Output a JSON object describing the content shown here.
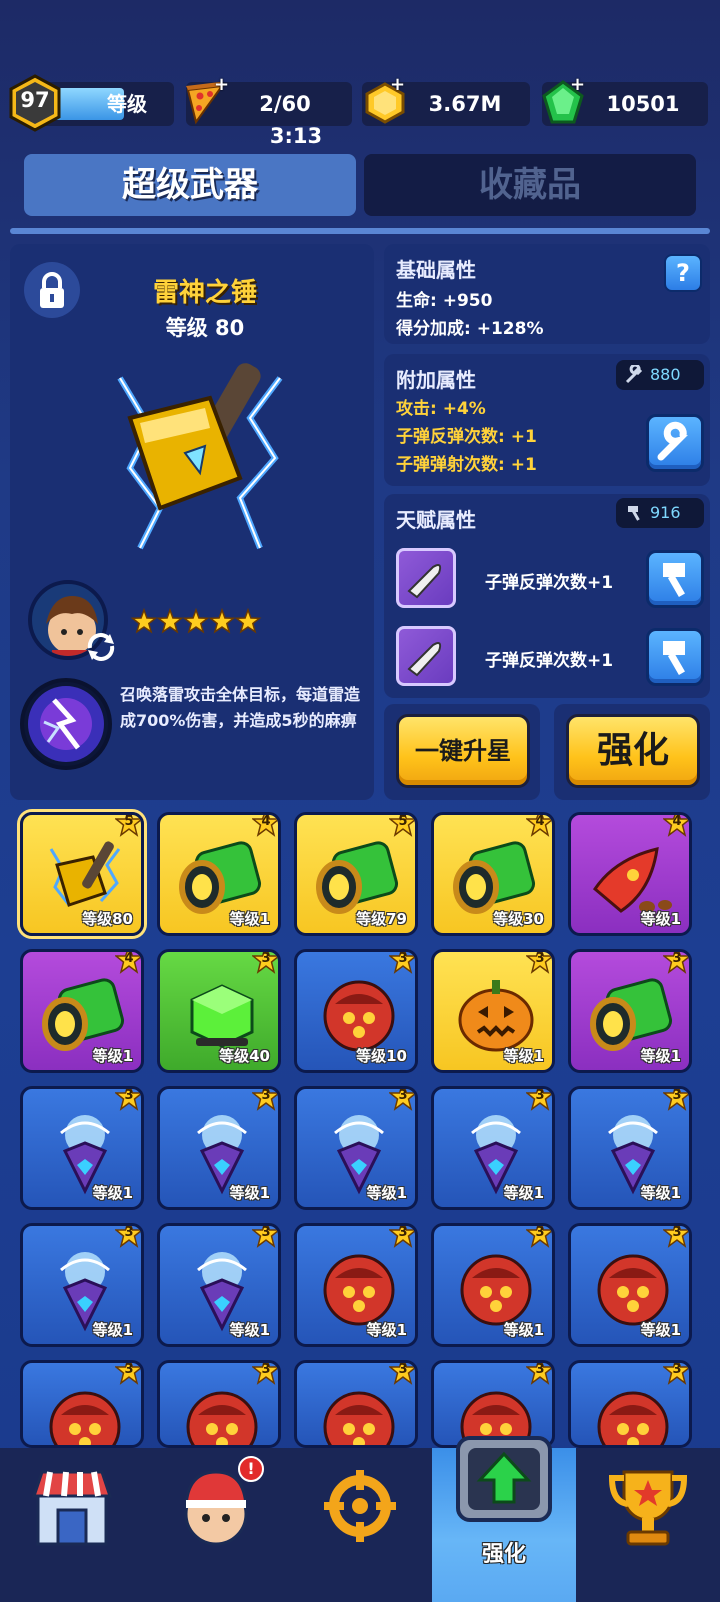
{
  "top_bar": {
    "player_level": "97",
    "level_label": "等级",
    "energy": "2/60",
    "energy_timer": "3:13",
    "coins": "3.67M",
    "gems": "10501"
  },
  "tabs": [
    {
      "label": "超级武器",
      "active": true
    },
    {
      "label": "收藏品",
      "active": false
    }
  ],
  "weapon": {
    "name": "雷神之锤",
    "level_text": "等级 80",
    "stars": 5,
    "skill_description": "召唤落雷攻击全体目标，每道雷造成700%伤害，并造成5秒的麻痹"
  },
  "base_attributes": {
    "title": "基础属性",
    "help_icon": "?",
    "lines": [
      "生命: +950",
      "得分加成: +128%"
    ]
  },
  "extra_attributes": {
    "title": "附加属性",
    "cost": "880",
    "lines": [
      "攻击: +4%",
      "子弹反弹次数: +1",
      "子弹弹射次数: +1"
    ]
  },
  "talent_attributes": {
    "title": "天赋属性",
    "cost": "916",
    "items": [
      {
        "label": "子弹反弹次数+1"
      },
      {
        "label": "子弹反弹次数+1"
      }
    ]
  },
  "actions": {
    "one_click_star": "一键升星",
    "enhance": "强化"
  },
  "grid": [
    {
      "kind": "hammer",
      "color": "gold",
      "stars": "5",
      "level": "等级80",
      "selected": true
    },
    {
      "kind": "cannon",
      "color": "gold",
      "stars": "4",
      "level": "等级1"
    },
    {
      "kind": "cannon",
      "color": "gold",
      "stars": "5",
      "level": "等级79"
    },
    {
      "kind": "cannon",
      "color": "gold",
      "stars": "4",
      "level": "等级30"
    },
    {
      "kind": "rocket",
      "color": "purple",
      "stars": "4",
      "level": "等级1"
    },
    {
      "kind": "cannon",
      "color": "purple",
      "stars": "4",
      "level": "等级1"
    },
    {
      "kind": "slime",
      "color": "green",
      "stars": "3",
      "level": "等级40"
    },
    {
      "kind": "mine",
      "color": "blue",
      "stars": "3",
      "level": "等级10"
    },
    {
      "kind": "pumpkin",
      "color": "gold",
      "stars": "3",
      "level": "等级1"
    },
    {
      "kind": "cannon",
      "color": "purple",
      "stars": "3",
      "level": "等级1"
    },
    {
      "kind": "crystal",
      "color": "blue",
      "stars": "3",
      "level": "等级1"
    },
    {
      "kind": "crystal",
      "color": "blue",
      "stars": "3",
      "level": "等级1"
    },
    {
      "kind": "crystal",
      "color": "blue",
      "stars": "3",
      "level": "等级1"
    },
    {
      "kind": "crystal",
      "color": "blue",
      "stars": "3",
      "level": "等级1"
    },
    {
      "kind": "crystal",
      "color": "blue",
      "stars": "3",
      "level": "等级1"
    },
    {
      "kind": "crystal",
      "color": "blue",
      "stars": "3",
      "level": "等级1"
    },
    {
      "kind": "crystal",
      "color": "blue",
      "stars": "3",
      "level": "等级1"
    },
    {
      "kind": "mine",
      "color": "blue",
      "stars": "3",
      "level": "等级1"
    },
    {
      "kind": "mine",
      "color": "blue",
      "stars": "3",
      "level": "等级1"
    },
    {
      "kind": "mine",
      "color": "blue",
      "stars": "3",
      "level": "等级1"
    },
    {
      "kind": "mine",
      "color": "blue",
      "stars": "3",
      "level": "",
      "partial": true
    },
    {
      "kind": "mine",
      "color": "blue",
      "stars": "3",
      "level": "",
      "partial": true
    },
    {
      "kind": "mine",
      "color": "blue",
      "stars": "3",
      "level": "",
      "partial": true
    },
    {
      "kind": "mine",
      "color": "blue",
      "stars": "3",
      "level": "",
      "partial": true
    },
    {
      "kind": "mine",
      "color": "blue",
      "stars": "3",
      "level": "",
      "partial": true
    }
  ],
  "bottom_nav": [
    {
      "icon": "shop-icon",
      "label": ""
    },
    {
      "icon": "hero-icon",
      "label": "",
      "badge": "!"
    },
    {
      "icon": "target-icon",
      "label": ""
    },
    {
      "icon": "upgrade-icon",
      "label": "强化",
      "active": true
    },
    {
      "icon": "trophy-icon",
      "label": ""
    }
  ],
  "colors": {
    "accent_gold": "#ffd23a",
    "panel": "#1a2f73",
    "tab_active": "#4a76c4",
    "tab_inactive": "#131c45"
  }
}
